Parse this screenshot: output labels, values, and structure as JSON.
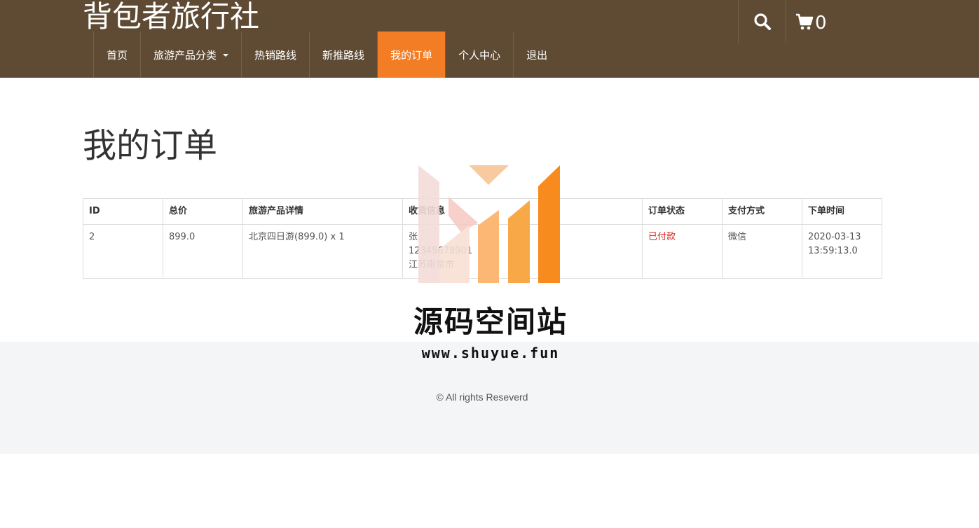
{
  "header": {
    "brand": "背包者旅行社",
    "cart_count": "0",
    "nav": [
      {
        "label": "首页"
      },
      {
        "label": "旅游产品分类"
      },
      {
        "label": "热销路线"
      },
      {
        "label": "新推路线"
      },
      {
        "label": "我的订单"
      },
      {
        "label": "个人中心"
      },
      {
        "label": "退出"
      }
    ],
    "active_nav": "我的订单",
    "colors": {
      "background": "#5f4b34",
      "active": "#f37d24"
    }
  },
  "main": {
    "title": "我的订单",
    "table": {
      "columns": [
        "ID",
        "总价",
        "旅游产品详情",
        "收货信息",
        "订单状态",
        "支付方式",
        "下单时间"
      ],
      "rows": [
        {
          "id": "2",
          "total": "899.0",
          "product": "北京四日游(899.0) x 1",
          "receiver_name": "张",
          "receiver_phone": "12345678901",
          "receiver_address": "江苏南京市",
          "status": "已付款",
          "payment": "微信",
          "time_date": "2020-03-13",
          "time_clock": "13:59:13.0"
        }
      ]
    }
  },
  "watermark": {
    "text": "源码空间站",
    "url": "www.shuyue.fun"
  },
  "footer": {
    "copyright": "© All rights Reseverd"
  }
}
